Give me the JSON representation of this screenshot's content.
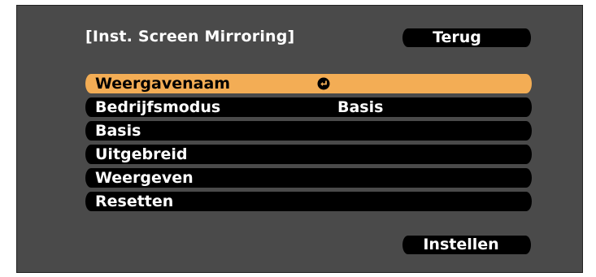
{
  "dialog": {
    "title": "[Inst. Screen Mirroring]",
    "back_label": "Terug",
    "set_label": "Instellen"
  },
  "menu": {
    "items": [
      {
        "label": "Weergavenaam",
        "value": "",
        "selected": true,
        "icon": "enter-icon"
      },
      {
        "label": "Bedrijfsmodus",
        "value": "Basis",
        "selected": false
      },
      {
        "label": "Basis",
        "value": "",
        "selected": false
      },
      {
        "label": "Uitgebreid",
        "value": "",
        "selected": false
      },
      {
        "label": "Weergeven",
        "value": "",
        "selected": false
      },
      {
        "label": "Resetten",
        "value": "",
        "selected": false
      }
    ]
  },
  "colors": {
    "panel_background": "#4a4a4a",
    "item_background": "#000000",
    "selected_background": "#f3ad55",
    "text": "#ffffff",
    "selected_text": "#000000"
  }
}
